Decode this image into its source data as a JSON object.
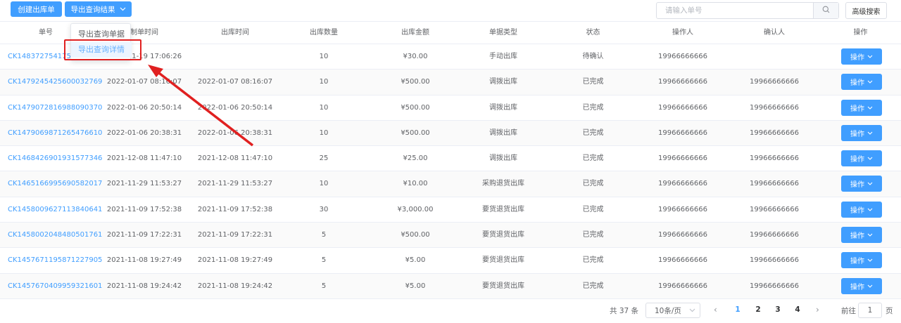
{
  "toolbar": {
    "create_label": "创建出库单",
    "export_label": "导出查询结果",
    "search_placeholder": "请输入单号",
    "advanced_label": "高级搜索"
  },
  "dropdown": {
    "items": [
      "导出查询单据",
      "导出查询详情"
    ],
    "active_index": 1
  },
  "table": {
    "headers": [
      "单号",
      "制单时间",
      "出库时间",
      "出库数量",
      "出库金额",
      "单据类型",
      "状态",
      "操作人",
      "确认人",
      "操作"
    ],
    "rows": [
      {
        "no": "CK1483727541750",
        "created": "2022-01-19 17:06:26",
        "out_time": "",
        "qty": "10",
        "amount": "¥30.00",
        "type": "手动出库",
        "status": "待确认",
        "operator": "19966666666",
        "confirmer": "",
        "op": "操作"
      },
      {
        "no": "CK1479245425600032769",
        "created": "2022-01-07 08:16:07",
        "out_time": "2022-01-07 08:16:07",
        "qty": "10",
        "amount": "¥500.00",
        "type": "调拨出库",
        "status": "已完成",
        "operator": "19966666666",
        "confirmer": "19966666666",
        "op": "操作"
      },
      {
        "no": "CK1479072816988090370",
        "created": "2022-01-06 20:50:14",
        "out_time": "2022-01-06 20:50:14",
        "qty": "10",
        "amount": "¥500.00",
        "type": "调拨出库",
        "status": "已完成",
        "operator": "19966666666",
        "confirmer": "19966666666",
        "op": "操作"
      },
      {
        "no": "CK1479069871265476610",
        "created": "2022-01-06 20:38:31",
        "out_time": "2022-01-06 20:38:31",
        "qty": "10",
        "amount": "¥500.00",
        "type": "调拨出库",
        "status": "已完成",
        "operator": "19966666666",
        "confirmer": "19966666666",
        "op": "操作"
      },
      {
        "no": "CK1468426901931577346",
        "created": "2021-12-08 11:47:10",
        "out_time": "2021-12-08 11:47:10",
        "qty": "25",
        "amount": "¥25.00",
        "type": "调拨出库",
        "status": "已完成",
        "operator": "19966666666",
        "confirmer": "19966666666",
        "op": "操作"
      },
      {
        "no": "CK1465166995690582017",
        "created": "2021-11-29 11:53:27",
        "out_time": "2021-11-29 11:53:27",
        "qty": "10",
        "amount": "¥10.00",
        "type": "采购退货出库",
        "status": "已完成",
        "operator": "19966666666",
        "confirmer": "19966666666",
        "op": "操作"
      },
      {
        "no": "CK1458009627113840641",
        "created": "2021-11-09 17:52:38",
        "out_time": "2021-11-09 17:52:38",
        "qty": "30",
        "amount": "¥3,000.00",
        "type": "要货退货出库",
        "status": "已完成",
        "operator": "19966666666",
        "confirmer": "19966666666",
        "op": "操作"
      },
      {
        "no": "CK1458002048480501761",
        "created": "2021-11-09 17:22:31",
        "out_time": "2021-11-09 17:22:31",
        "qty": "5",
        "amount": "¥500.00",
        "type": "要货退货出库",
        "status": "已完成",
        "operator": "19966666666",
        "confirmer": "19966666666",
        "op": "操作"
      },
      {
        "no": "CK1457671195871227905",
        "created": "2021-11-08 19:27:49",
        "out_time": "2021-11-08 19:27:49",
        "qty": "5",
        "amount": "¥5.00",
        "type": "要货退货出库",
        "status": "已完成",
        "operator": "19966666666",
        "confirmer": "19966666666",
        "op": "操作"
      },
      {
        "no": "CK1457670409959321601",
        "created": "2021-11-08 19:24:42",
        "out_time": "2021-11-08 19:24:42",
        "qty": "5",
        "amount": "¥5.00",
        "type": "要货退货出库",
        "status": "已完成",
        "operator": "19966666666",
        "confirmer": "19966666666",
        "op": "操作"
      }
    ]
  },
  "pagination": {
    "total_label": "共 37 条",
    "page_size_label": "10条/页",
    "pages": [
      "1",
      "2",
      "3",
      "4"
    ],
    "current_page": "1",
    "goto_prefix": "前往",
    "goto_value": "1",
    "goto_suffix": "页"
  },
  "colors": {
    "primary": "#409eff",
    "annotation": "#e02020"
  }
}
